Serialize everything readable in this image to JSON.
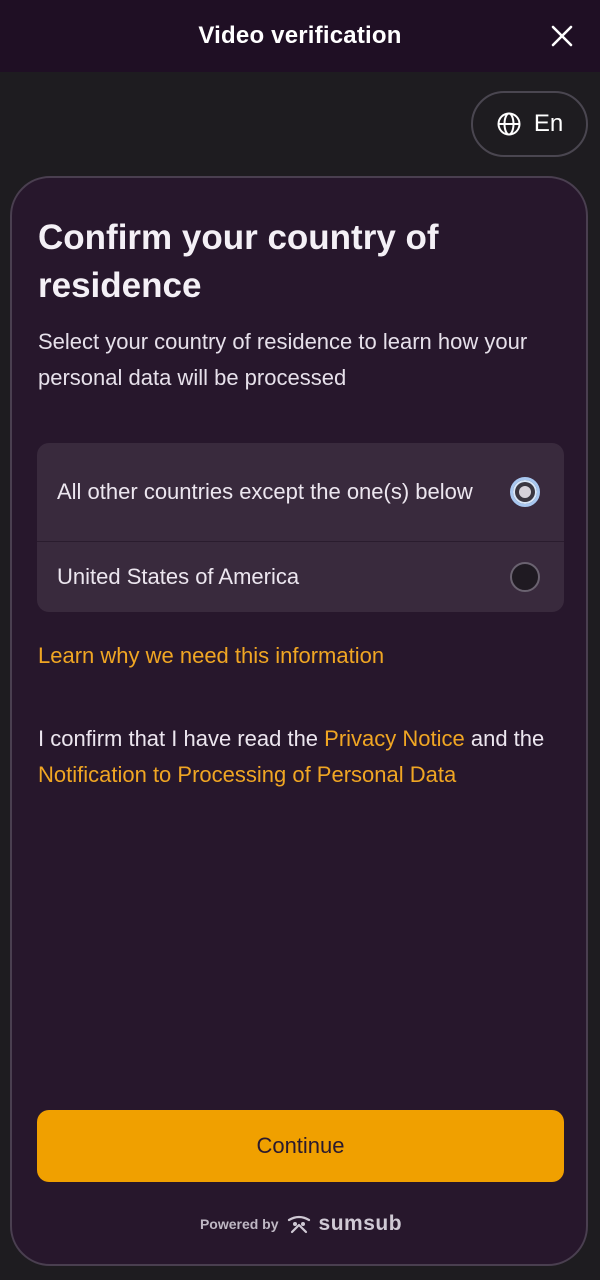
{
  "header": {
    "title": "Video verification",
    "close_icon": "close-icon"
  },
  "language": {
    "label": "En",
    "icon": "globe-icon"
  },
  "content": {
    "heading": "Confirm your country of residence",
    "subtext": "Select your country of residence to learn how your personal data will be processed",
    "options": [
      {
        "label": "All other countries except the one(s) below",
        "selected": true
      },
      {
        "label": "United States of America",
        "selected": false
      }
    ],
    "learn_link": "Learn why we need this information",
    "confirm": {
      "prefix": "I confirm that I have read the ",
      "privacy_link": "Privacy Notice",
      "middle": " and the ",
      "notification_link": "Notification to Processing of Personal Data"
    },
    "continue_label": "Continue"
  },
  "footer": {
    "powered_by": "Powered by",
    "brand": "sumsub",
    "brand_icon": "sumsub-logo-icon"
  },
  "colors": {
    "accent": "#f0a000",
    "link": "#f0a623",
    "card_bg": "#27172c",
    "header_bg": "#1f0f24"
  }
}
